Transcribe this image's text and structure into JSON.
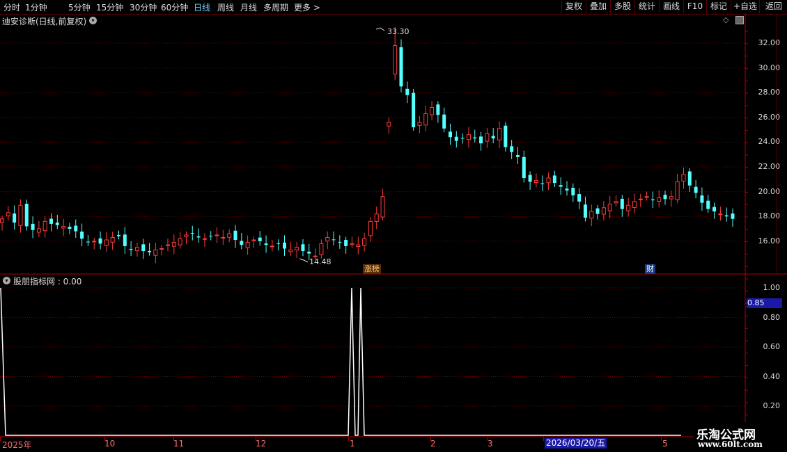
{
  "toolbar": {
    "periods": [
      "分时",
      "1分钟",
      "5分钟",
      "15分钟",
      "30分钟",
      "60分钟",
      "日线",
      "周线",
      "月线",
      "多周期",
      "更多"
    ],
    "active_period": "日线",
    "more_arrow": ">",
    "right_buttons": [
      "复权",
      "叠加",
      "多股",
      "统计",
      "画线",
      "F10",
      "标记",
      "+自选",
      "返回"
    ]
  },
  "main_chart": {
    "title": "迪安诊断(日线,前复权)",
    "high_label": "33.30",
    "low_label": "14.48",
    "badge_zhangbang": "涨榜",
    "badge_cai": "财",
    "yaxis_labels": [
      "32.00",
      "30.00",
      "28.00",
      "26.00",
      "24.00",
      "22.00",
      "20.00",
      "18.00",
      "16.00"
    ]
  },
  "indicator": {
    "title": "股朋指标网 : 0.00",
    "yaxis_labels": [
      "1.00",
      "0.80",
      "0.60",
      "0.40",
      "0.20"
    ],
    "current_value": "0.85"
  },
  "xaxis": {
    "labels": [
      "2025年",
      "10",
      "11",
      "12",
      "1",
      "2",
      "3",
      "5"
    ],
    "highlight_date": "2026/03/20/五"
  },
  "watermark": {
    "line1": "乐淘公式网",
    "line2": "www.60lt.com"
  },
  "colors": {
    "up": "#ff3c3c",
    "down": "#54ffff",
    "grid": "#6a0000",
    "text": "#dddddd",
    "active": "#6fd3ff"
  },
  "chart_data": {
    "type": "candlestick",
    "ylim": [
      14.0,
      33.6
    ],
    "high": 33.3,
    "low": 14.48,
    "close_series": [
      17.8,
      18.3,
      17.5,
      18.9,
      17.2,
      16.9,
      17.0,
      17.6,
      17.4,
      17.3,
      17.2,
      17.0,
      16.8,
      16.2,
      15.9,
      16.0,
      15.8,
      16.1,
      16.3,
      16.4,
      15.6,
      15.3,
      15.5,
      15.2,
      15.1,
      15.3,
      15.4,
      15.7,
      15.9,
      16.2,
      16.5,
      16.6,
      16.3,
      16.2,
      16.4,
      16.5,
      16.3,
      16.6,
      16.1,
      15.7,
      15.9,
      16.1,
      16.0,
      15.7,
      15.6,
      15.8,
      15.4,
      15.3,
      15.5,
      15.2,
      15.0,
      14.8,
      15.8,
      16.3,
      16.1,
      15.9,
      15.6,
      15.8,
      15.7,
      16.2,
      17.6,
      18.2,
      19.6,
      25.6,
      31.8,
      28.5,
      27.8,
      25.2,
      25.6,
      26.3,
      26.8,
      26.2,
      25.1,
      24.4,
      24.1,
      24.3,
      24.6,
      24.3,
      23.9,
      24.7,
      24.3,
      25.1,
      23.6,
      23.2,
      22.8,
      21.1,
      20.8,
      20.9,
      20.6,
      21.1,
      20.7,
      20.4,
      20.1,
      19.7,
      19.2,
      17.9,
      18.4,
      18.2,
      18.7,
      19.0,
      19.2,
      18.6,
      18.9,
      19.2,
      19.4,
      19.6,
      19.3,
      19.5,
      19.4,
      19.6,
      20.8,
      21.4,
      20.5,
      19.9,
      19.1,
      18.6,
      18.4,
      18.2,
      18.0,
      17.8
    ]
  }
}
